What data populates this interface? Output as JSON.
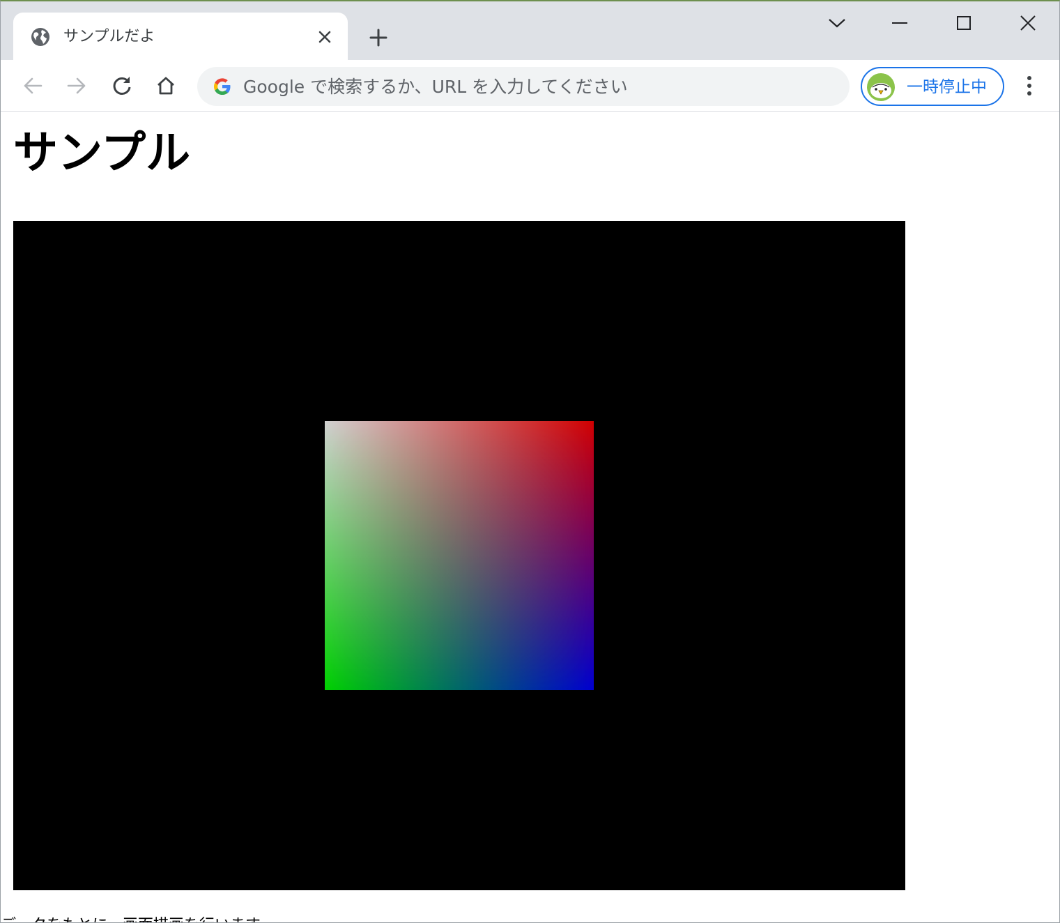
{
  "browser": {
    "tab": {
      "title": "サンプルだよ",
      "favicon": "globe-icon"
    },
    "omnibox": {
      "placeholder": "Google で検索するか、URL を入力してください",
      "value": ""
    },
    "profile": {
      "label": "一時停止中"
    },
    "icons": {
      "tab_search": "chevron-down-icon",
      "minimize": "minimize-icon",
      "maximize": "maximize-icon",
      "close": "close-icon",
      "new_tab": "plus-icon",
      "back": "arrow-left-icon",
      "forward": "arrow-right-icon",
      "reload": "reload-icon",
      "home": "home-icon",
      "menu": "kebab-menu-icon"
    },
    "colors": {
      "tabstrip_bg": "#dee1e6",
      "accent": "#1a73e8",
      "omnibox_bg": "#f1f3f4"
    }
  },
  "page": {
    "heading": "サンプル",
    "canvas": {
      "background": "#000000",
      "quad_corner_colors": {
        "top_left": "#ffffff",
        "top_right": "#ff0000",
        "bottom_left": "#00ff00",
        "bottom_right": "#0000ff"
      }
    },
    "footer_text": "データをもとに、画面描画を行います"
  }
}
